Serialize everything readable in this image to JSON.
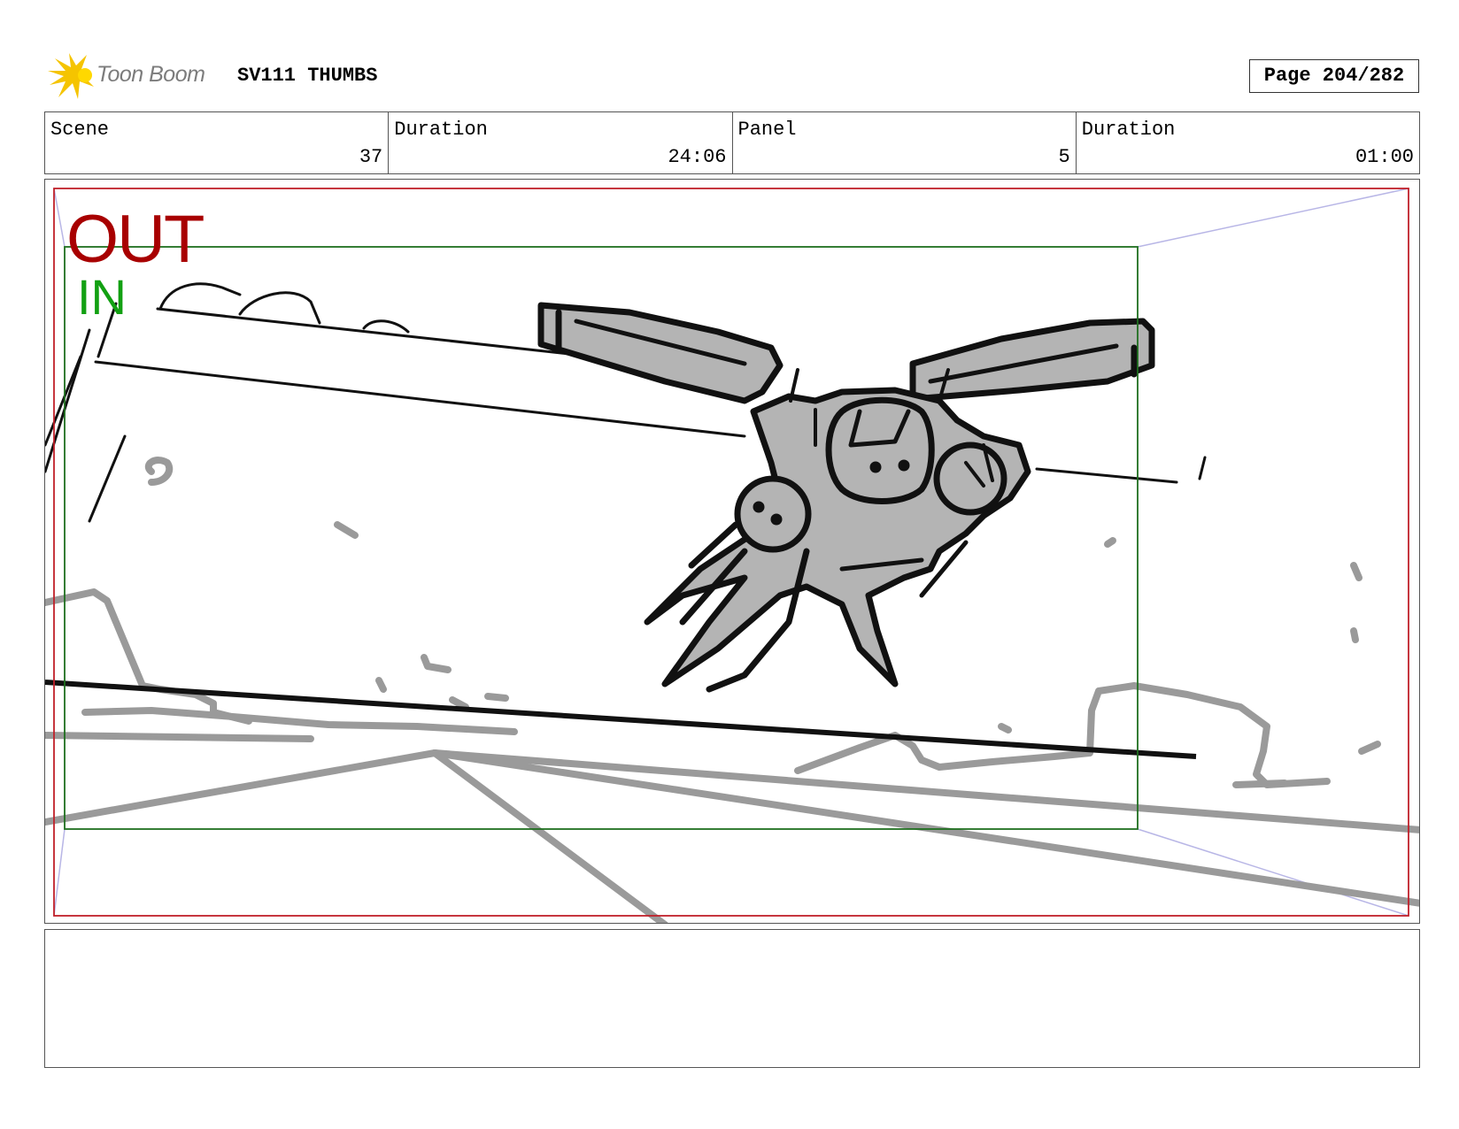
{
  "header": {
    "logo_text": "Toon Boom",
    "project_title": "SV111 THUMBS",
    "page_label": "Page 204/282"
  },
  "info": [
    {
      "label": "Scene",
      "value": "37"
    },
    {
      "label": "Duration",
      "value": "24:06"
    },
    {
      "label": "Panel",
      "value": "5"
    },
    {
      "label": "Duration",
      "value": "01:00"
    }
  ],
  "panel": {
    "out_label": "OUT",
    "in_label": "IN",
    "colors": {
      "out_frame": "#c0202a",
      "in_frame": "#1f6f1f",
      "camera_path": "#b8b6e6"
    }
  },
  "notes": {
    "text": ""
  }
}
